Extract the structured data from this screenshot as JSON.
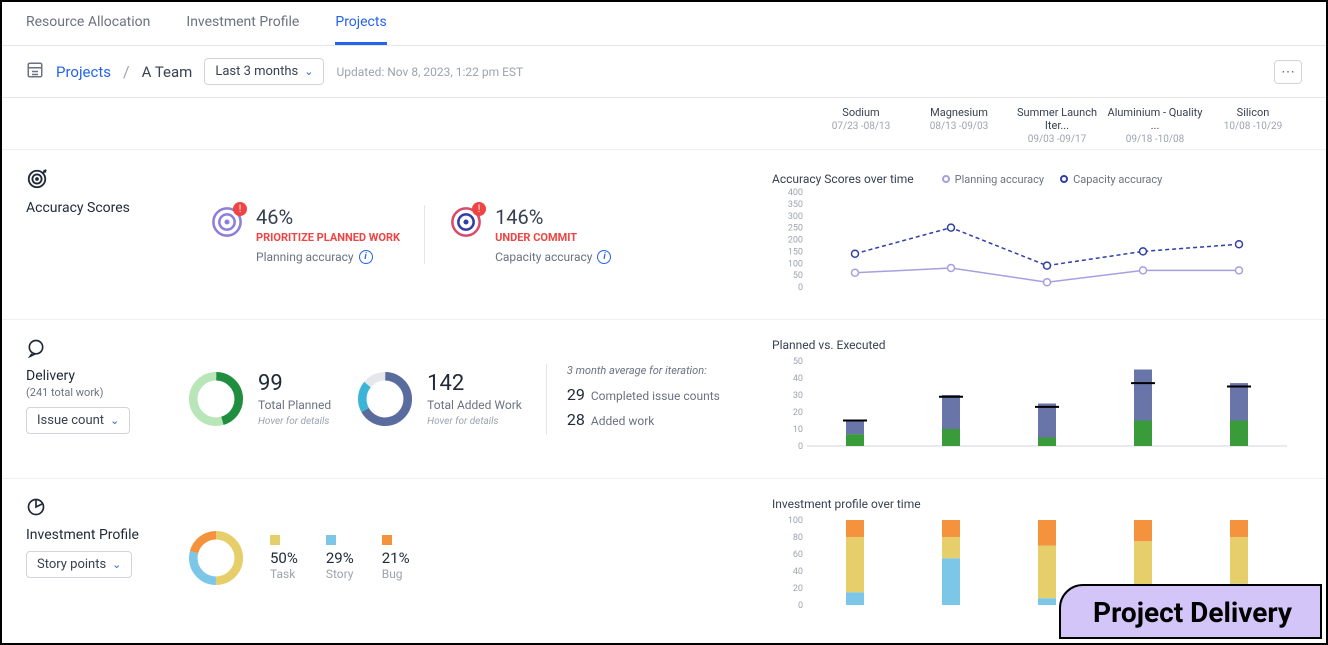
{
  "tabs": [
    {
      "label": "Resource Allocation",
      "active": false
    },
    {
      "label": "Investment Profile",
      "active": false
    },
    {
      "label": "Projects",
      "active": true
    }
  ],
  "breadcrumb": {
    "root": "Projects",
    "current": "A Team"
  },
  "timeframe": "Last 3 months",
  "updated": "Updated: Nov 8, 2023, 1:22 pm EST",
  "iterations": [
    {
      "name": "Sodium",
      "dates": "07/23 -08/13"
    },
    {
      "name": "Magnesium",
      "dates": "08/13 -09/03"
    },
    {
      "name": "Summer Launch Iter...",
      "dates": "09/03 -09/17"
    },
    {
      "name": "Aluminium - Quality ...",
      "dates": "09/18 -10/08"
    },
    {
      "name": "Silicon",
      "dates": "10/08 -10/29"
    }
  ],
  "accuracy": {
    "section_title": "Accuracy Scores",
    "planning": {
      "value": "46%",
      "warn": "PRIORITIZE PLANNED WORK",
      "label": "Planning accuracy"
    },
    "capacity": {
      "value": "146%",
      "warn": "UNDER COMMIT",
      "label": "Capacity accuracy"
    },
    "chart_title": "Accuracy Scores over time",
    "legend": {
      "a": "Planning accuracy",
      "b": "Capacity accuracy"
    }
  },
  "delivery": {
    "section_title": "Delivery",
    "total_work": "(241 total work)",
    "selector": "Issue count",
    "planned": {
      "value": "99",
      "label": "Total Planned",
      "hint": "Hover for details"
    },
    "added": {
      "value": "142",
      "label": "Total Added Work",
      "hint": "Hover for details"
    },
    "avg_title": "3 month average for iteration:",
    "avg1": {
      "num": "29",
      "label": "Completed issue counts"
    },
    "avg2": {
      "num": "28",
      "label": "Added work"
    },
    "chart_title": "Planned vs. Executed"
  },
  "investment": {
    "section_title": "Investment Profile",
    "selector": "Story points",
    "items": [
      {
        "pct": "50%",
        "label": "Task",
        "color": "#e6cf6a"
      },
      {
        "pct": "29%",
        "label": "Story",
        "color": "#7cc7e8"
      },
      {
        "pct": "21%",
        "label": "Bug",
        "color": "#f5923e"
      }
    ],
    "chart_title": "Investment profile over time"
  },
  "banner": "Project Delivery",
  "chart_data": [
    {
      "id": "accuracy_over_time",
      "type": "line",
      "categories": [
        "Sodium",
        "Magnesium",
        "Summer Launch",
        "Aluminium",
        "Silicon"
      ],
      "series": [
        {
          "name": "Planning accuracy",
          "color": "#a5a0e0",
          "values": [
            60,
            80,
            20,
            70,
            70
          ]
        },
        {
          "name": "Capacity accuracy",
          "color": "#2f3ea8",
          "values": [
            140,
            250,
            90,
            150,
            180
          ]
        }
      ],
      "ylabel": "",
      "ylim": [
        0,
        400
      ],
      "yticks": [
        0,
        50,
        100,
        150,
        200,
        250,
        300,
        350,
        400
      ]
    },
    {
      "id": "planned_vs_executed",
      "type": "bar",
      "categories": [
        "Sodium",
        "Magnesium",
        "Summer Launch",
        "Aluminium",
        "Silicon"
      ],
      "series": [
        {
          "name": "Completed",
          "color": "#3a9b3a",
          "values": [
            7,
            10,
            5,
            15,
            15
          ]
        },
        {
          "name": "Added",
          "color": "#6974a8",
          "values": [
            8,
            20,
            20,
            30,
            22
          ]
        },
        {
          "name": "Planned-marker",
          "color": "#000",
          "values": [
            15,
            29,
            23,
            37,
            35
          ]
        }
      ],
      "ylim": [
        0,
        50
      ],
      "yticks": [
        0,
        10,
        20,
        30,
        40,
        50
      ]
    },
    {
      "id": "investment_over_time",
      "type": "bar-stacked-100",
      "categories": [
        "Sodium",
        "Magnesium",
        "Summer Launch",
        "Aluminium",
        "Silicon"
      ],
      "series": [
        {
          "name": "Story",
          "color": "#7cc7e8",
          "values": [
            15,
            55,
            8,
            20,
            25
          ]
        },
        {
          "name": "Task",
          "color": "#e6cf6a",
          "values": [
            65,
            25,
            62,
            55,
            55
          ]
        },
        {
          "name": "Bug",
          "color": "#f5923e",
          "values": [
            20,
            20,
            30,
            25,
            20
          ]
        }
      ],
      "ylim": [
        0,
        100
      ],
      "yticks": [
        0,
        20,
        40,
        60,
        80,
        100
      ]
    },
    {
      "id": "delivery_planned_donut",
      "type": "donut",
      "total": 99,
      "series": [
        {
          "name": "segment-a",
          "color": "#1f8f3f",
          "value": 45
        },
        {
          "name": "segment-b",
          "color": "#b8e6b8",
          "value": 54
        }
      ]
    },
    {
      "id": "delivery_added_donut",
      "type": "donut",
      "total": 142,
      "series": [
        {
          "name": "segment-a",
          "color": "#5a6b9e",
          "value": 95
        },
        {
          "name": "segment-b",
          "color": "#3bb4d9",
          "value": 27
        },
        {
          "name": "segment-c",
          "color": "#e5e7eb",
          "value": 20
        }
      ]
    },
    {
      "id": "investment_donut",
      "type": "donut",
      "series": [
        {
          "name": "Task",
          "color": "#e6cf6a",
          "value": 50
        },
        {
          "name": "Story",
          "color": "#7cc7e8",
          "value": 29
        },
        {
          "name": "Bug",
          "color": "#f5923e",
          "value": 21
        }
      ]
    }
  ]
}
